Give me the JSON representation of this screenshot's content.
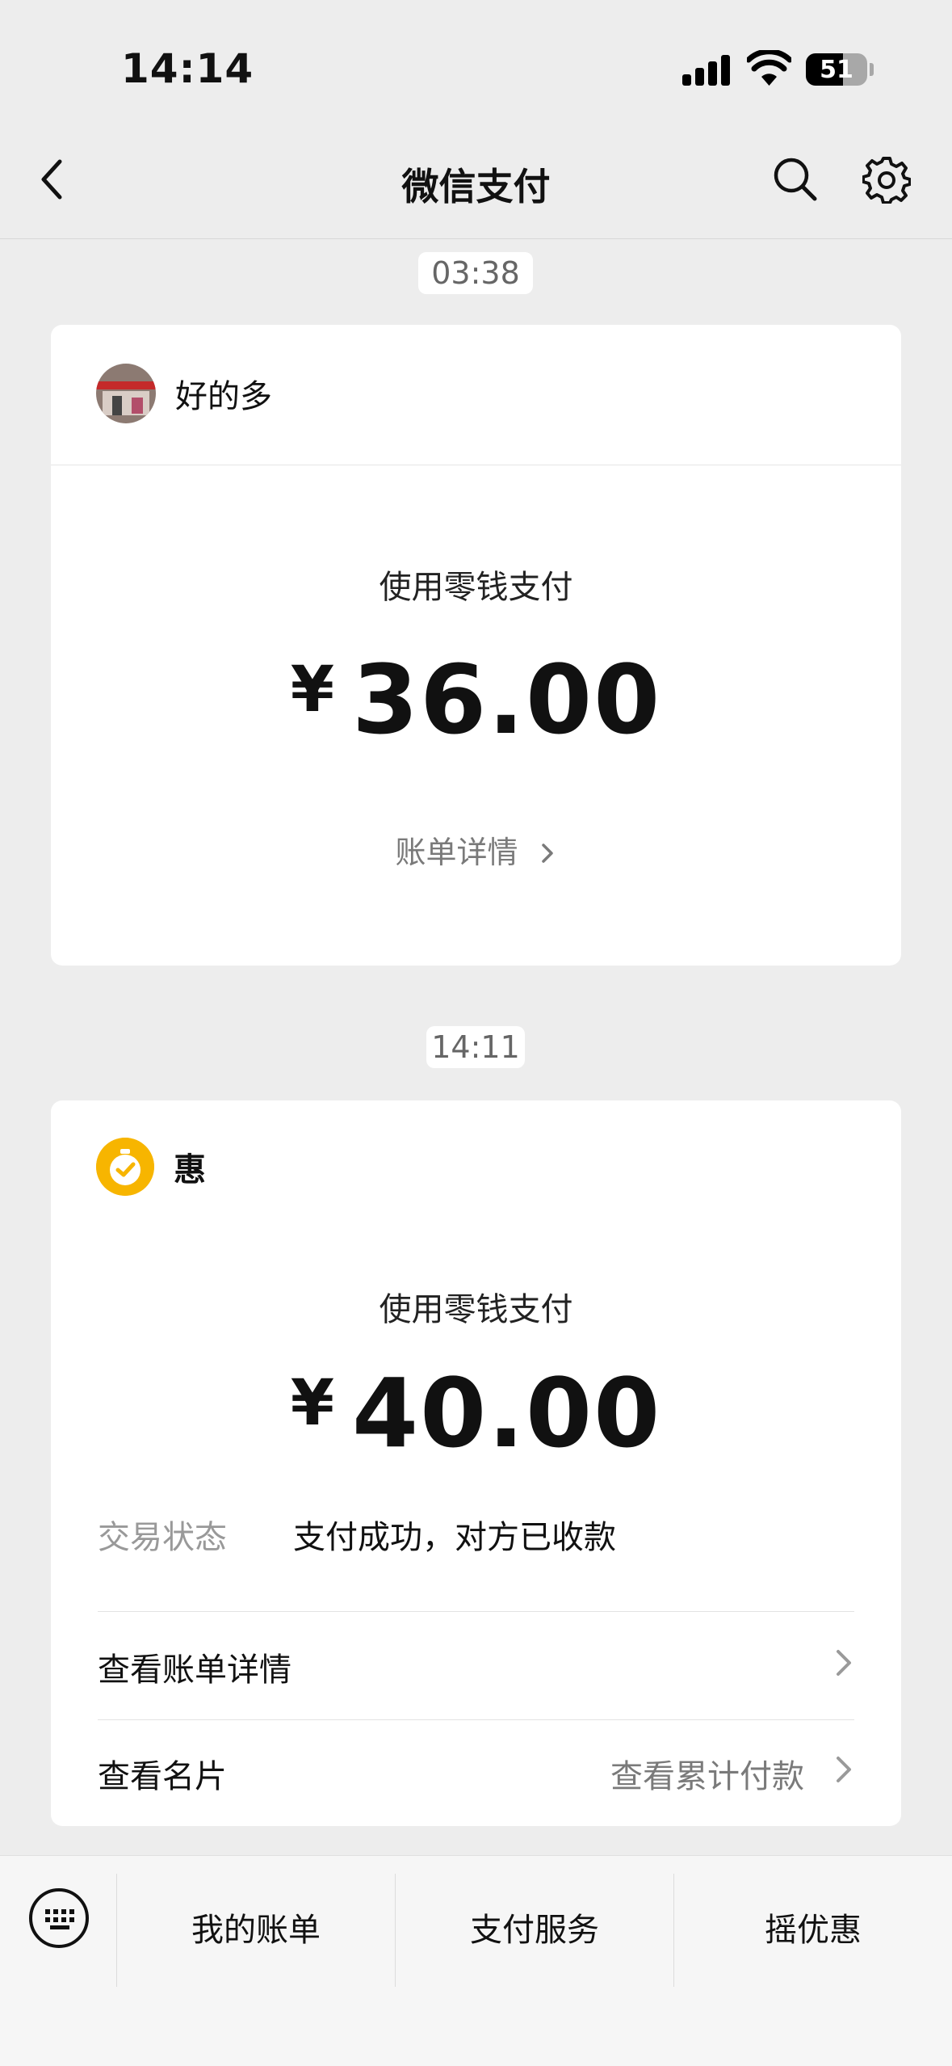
{
  "status_bar": {
    "time": "14:14",
    "battery": "51"
  },
  "nav": {
    "title": "微信支付"
  },
  "messages": [
    {
      "time": "03:38",
      "merchant": "好的多",
      "pay_method": "使用零钱支付",
      "currency": "¥",
      "amount": "36.00",
      "bill_link": "账单详情"
    },
    {
      "time": "14:11",
      "merchant": "惠",
      "pay_method": "使用零钱支付",
      "currency": "¥",
      "amount": "40.00",
      "status_label": "交易状态",
      "status_value": "支付成功，对方已收款",
      "bill_detail": "查看账单详情",
      "card_label": "查看名片",
      "cumulative": "查看累计付款"
    }
  ],
  "bottom_menu": {
    "items": [
      "我的账单",
      "支付服务",
      "摇优惠"
    ]
  },
  "colors": {
    "accent_yellow": "#f7b500",
    "background": "#ededed"
  }
}
